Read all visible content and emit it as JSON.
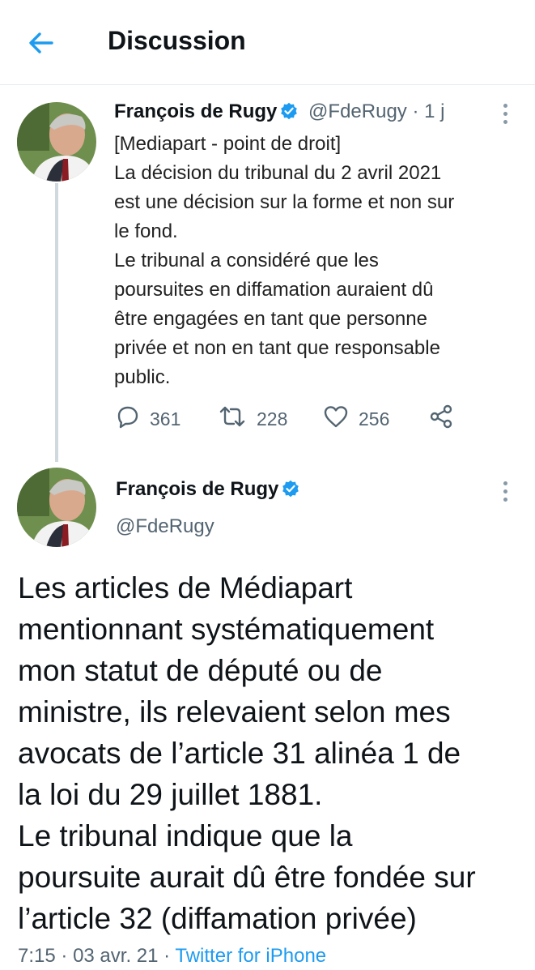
{
  "header": {
    "title": "Discussion"
  },
  "tweet1": {
    "author_name": "François de Rugy",
    "handle": "@FdeRugy",
    "time": "1 j",
    "body_lines": [
      "[Mediapart - point de droit]",
      "La décision du tribunal du 2 avril 2021",
      "est une décision sur la forme et non sur",
      "le fond.",
      "Le tribunal a considéré que les",
      "poursuites en diffamation auraient dû",
      "être engagées en tant que personne",
      "privée et non en tant que responsable",
      "public."
    ],
    "replies": "361",
    "retweets": "228",
    "likes": "256"
  },
  "tweet2": {
    "author_name": "François de Rugy",
    "handle": "@FdeRugy",
    "body_lines": [
      "Les articles de Médiapart",
      "mentionnant systématiquement",
      "mon statut de député ou de",
      "ministre, ils relevaient selon mes",
      "avocats de l’article 31 alinéa 1 de",
      "la loi du 29 juillet 1881.",
      "Le tribunal indique que la",
      "poursuite aurait dû être fondée sur",
      "l’article 32 (diffamation privée)"
    ],
    "time": "7:15",
    "date": "03 avr. 21",
    "source": "Twitter for iPhone"
  },
  "colors": {
    "accent": "#1d9bf0",
    "muted": "#536471",
    "border": "#e6ecf0"
  },
  "icons": [
    "back-arrow-icon",
    "verified-badge-icon",
    "more-icon",
    "reply-icon",
    "retweet-icon",
    "like-icon",
    "share-icon"
  ]
}
